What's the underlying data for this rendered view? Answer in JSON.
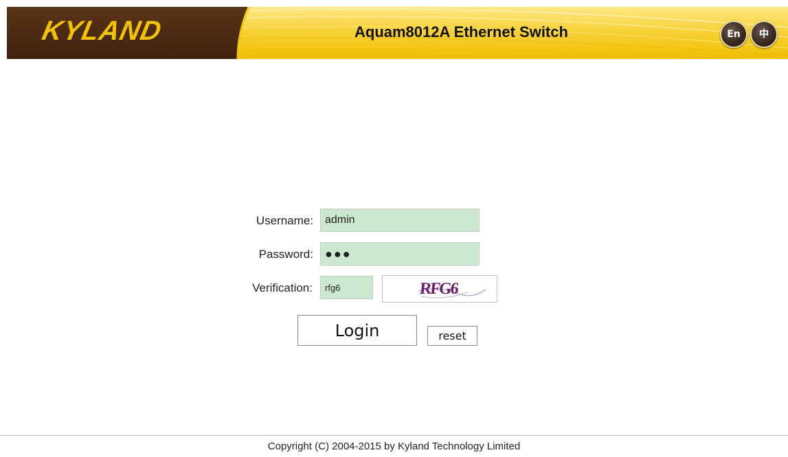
{
  "header": {
    "logo_text": "KYLAND",
    "device_title": "Aquam8012A Ethernet Switch",
    "lang_en_label": "En",
    "lang_cn_label": "中",
    "colors": {
      "banner_dark": "#4a2a12",
      "banner_gold": "#f5c800",
      "banner_light": "#fde886",
      "logo": "#f2c200"
    }
  },
  "login_form": {
    "username_label": "Username:",
    "username_value": "admin",
    "password_label": "Password:",
    "password_value": "●●●",
    "verification_label": "Verification:",
    "verification_value": "rfg6",
    "captcha_text": "RFG6",
    "login_label": "Login",
    "reset_label": "reset",
    "colors": {
      "input_bg": "#cce8cf",
      "captcha_text": "#6b1e6b"
    }
  },
  "footer": {
    "copyright": "Copyright (C) 2004-2015 by Kyland Technology Limited"
  }
}
